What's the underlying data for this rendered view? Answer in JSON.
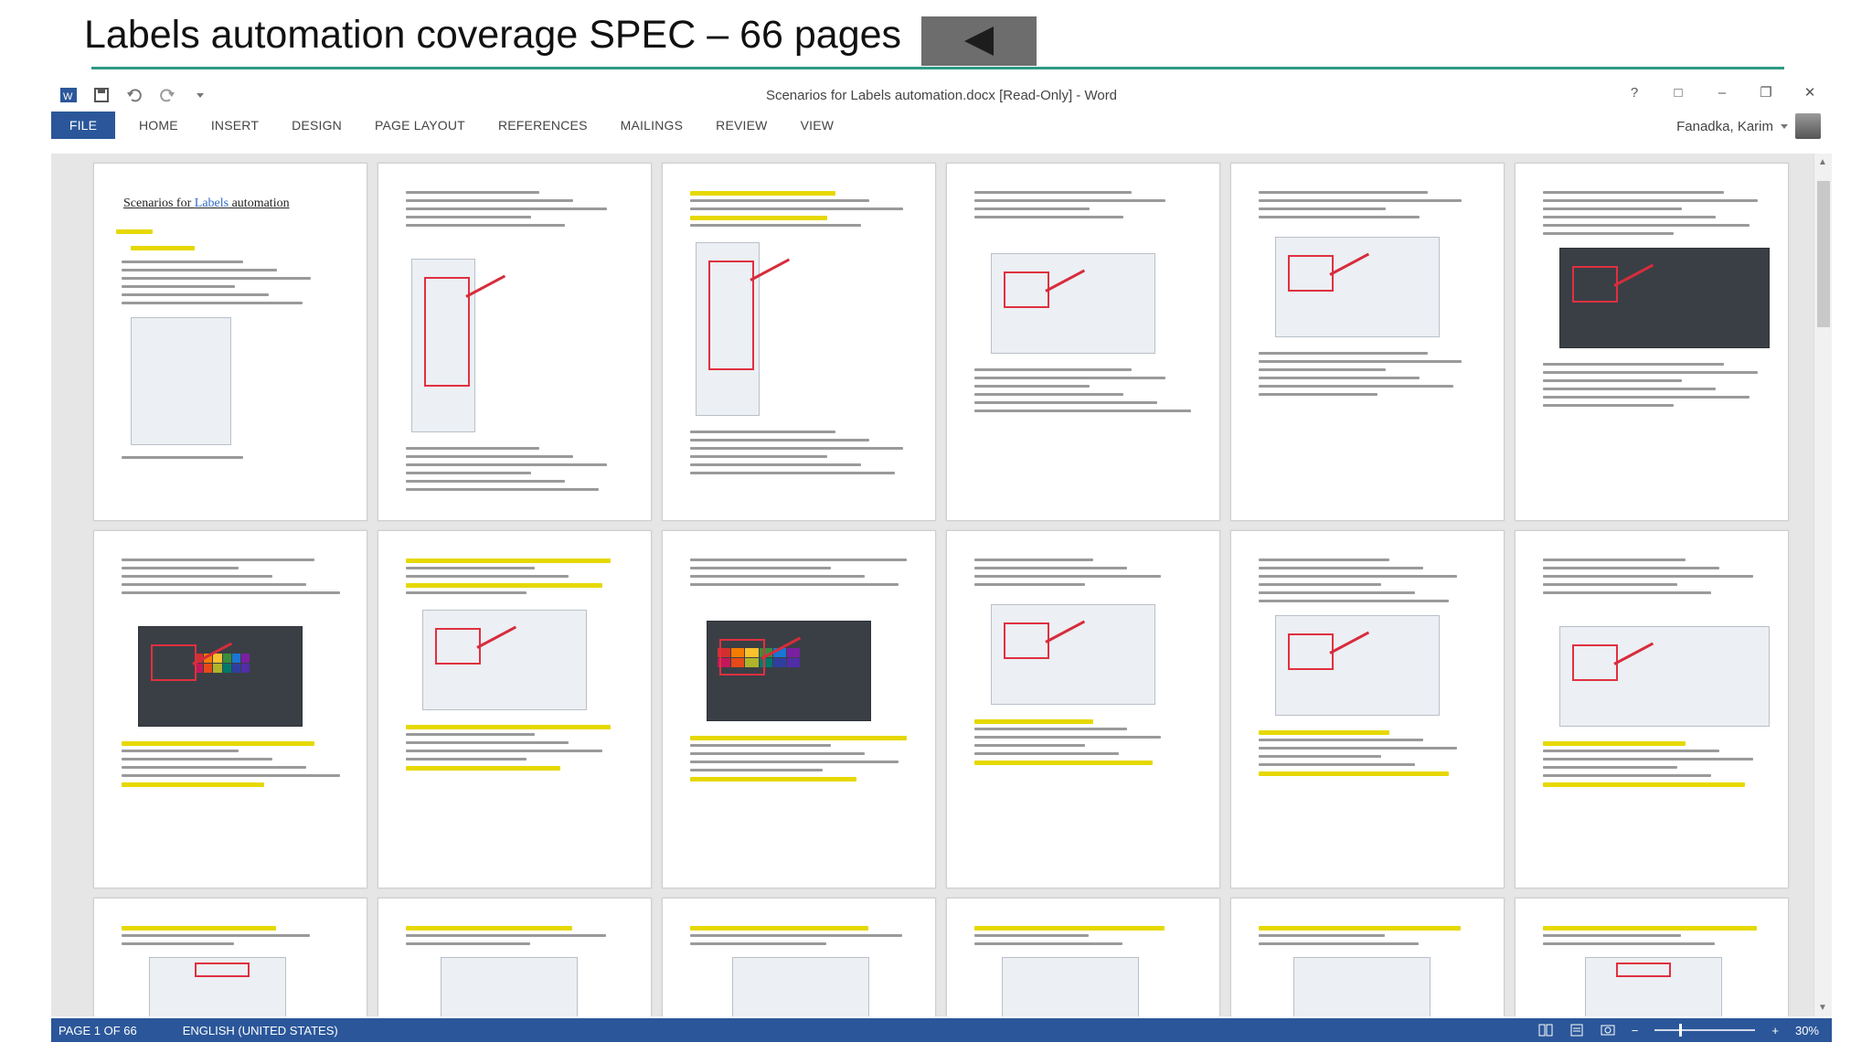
{
  "slide": {
    "title": "Labels automation coverage SPEC – 66 pages"
  },
  "word": {
    "window_title": "Scenarios for Labels automation.docx [Read-Only] - Word",
    "ribbon_tabs": [
      "FILE",
      "HOME",
      "INSERT",
      "DESIGN",
      "PAGE LAYOUT",
      "REFERENCES",
      "MAILINGS",
      "REVIEW",
      "VIEW"
    ],
    "user_name": "Fanadka, Karim",
    "window_controls": [
      "?",
      "□",
      "–",
      "❐",
      "✕"
    ],
    "doc_heading": {
      "prefix": "Scenarios for ",
      "highlight": "Labels",
      "suffix": " automation"
    }
  },
  "status_bar": {
    "page_info": "PAGE 1 OF 66",
    "language": "ENGLISH (UNITED STATES)",
    "zoom": "30%",
    "zoom_level": 0.3
  },
  "colors": {
    "accent": "#2b579a",
    "teal_rule": "#2f9a83",
    "highlight": "#e6d800",
    "annotation_red": "#e03040"
  }
}
